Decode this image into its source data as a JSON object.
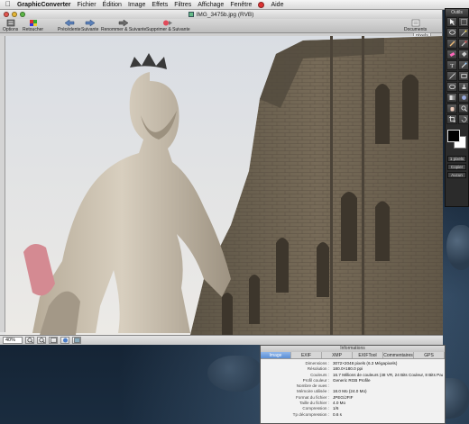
{
  "menubar": {
    "app_name": "GraphicConverter",
    "items": [
      "Fichier",
      "Édition",
      "Image",
      "Effets",
      "Filtres",
      "Affichage",
      "Fenêtre",
      "Aide"
    ]
  },
  "window": {
    "title": "IMG_3475b.jpg (RVB)",
    "toolbar": {
      "options": "Options",
      "retoucher": "Retoucher",
      "precedente": "Précédente",
      "suivante": "Suivante",
      "renommer_suivante": "Renommer & Suivante",
      "supprimer_suivante": "Supprimer & Suivante",
      "documents": "Documents"
    },
    "zoom_indicator": "pixels",
    "zoom_value": "40%"
  },
  "palette": {
    "title": "Outils",
    "field1": "1 pixels",
    "field2": "Copier",
    "field3": "Aucun"
  },
  "info_panel": {
    "title": "Informations",
    "tabs": [
      "Image",
      "EXIF",
      "XMP",
      "EXIFTool",
      "Commentaires",
      "GPS"
    ],
    "active_tab": "Image",
    "rows": [
      {
        "k": "Dimensions :",
        "v": "3072×2048 pixels (6.3 Mégapixels)"
      },
      {
        "k": "Résolution :",
        "v": "180.0×180.0 ppi"
      },
      {
        "k": "Couleurs :",
        "v": "16.7 Millions de couleurs (48 VR, 24 Bits Couleur, 8 Bits Padding)"
      },
      {
        "k": "Profil couleur :",
        "v": "Generic RGB Profile"
      },
      {
        "k": "Nombre de vues :",
        "v": ""
      },
      {
        "k": "Mémoire utilisée :",
        "v": "18.0 Mo (24.0 Mo)"
      },
      {
        "k": "Format du fichier :",
        "v": "JPEG/JFIF"
      },
      {
        "k": "Taille du fichier :",
        "v": "4.0 Mo"
      },
      {
        "k": "Compression :",
        "v": "1/6"
      },
      {
        "k": "Tp décompression :",
        "v": "0.6 s"
      }
    ]
  },
  "colors": {
    "active_tab": "#5a8fd6",
    "sky": "#e4e6ea",
    "wall": "#6e6454",
    "statue": "#c9bfae"
  }
}
